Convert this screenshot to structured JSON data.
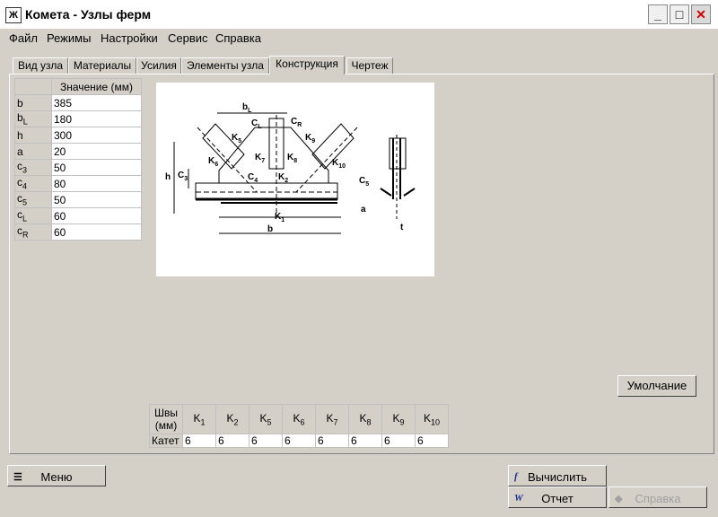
{
  "window": {
    "title": "Комета - Узлы ферм",
    "app_icon": "Ж"
  },
  "menu": [
    "Файл",
    "Режимы",
    "Настройки",
    "Сервис",
    "Справка"
  ],
  "tabs": [
    "Вид узла",
    "Материалы",
    "Усилия",
    "Элементы узла",
    "Конструкция",
    "Чертеж"
  ],
  "active_tab": 4,
  "params": {
    "header": "Значение (мм)",
    "rows": [
      {
        "key": "b",
        "sub": "",
        "value": "385"
      },
      {
        "key": "b",
        "sub": "L",
        "value": "180"
      },
      {
        "key": "h",
        "sub": "",
        "value": "300"
      },
      {
        "key": "a",
        "sub": "",
        "value": "20"
      },
      {
        "key": "c",
        "sub": "3",
        "value": "50"
      },
      {
        "key": "c",
        "sub": "4",
        "value": "80"
      },
      {
        "key": "c",
        "sub": "5",
        "value": "50"
      },
      {
        "key": "c",
        "sub": "L",
        "value": "60"
      },
      {
        "key": "c",
        "sub": "R",
        "value": "60"
      }
    ]
  },
  "drawing_labels": {
    "bL": "b",
    "bL_sub": "L",
    "CL": "C",
    "CL_sub": "L",
    "CR": "C",
    "CR_sub": "R",
    "K5": "K",
    "K5_sub": "5",
    "K9": "K",
    "K9_sub": "9",
    "K6": "K",
    "K6_sub": "6",
    "K7": "K",
    "K7_sub": "7",
    "K8": "K",
    "K8_sub": "8",
    "K10": "K",
    "K10_sub": "10",
    "h": "h",
    "C3": "C",
    "C3_sub": "3",
    "C4": "C",
    "C4_sub": "4",
    "K2": "K",
    "K2_sub": "2",
    "C5": "C",
    "C5_sub": "5",
    "a": "a",
    "K1": "K",
    "K1_sub": "1",
    "b": "b",
    "t": "t"
  },
  "default_button": "Умолчание",
  "welds": {
    "header_line1": "Швы",
    "header_line2": "(мм)",
    "row_label": "Катет",
    "cols": [
      {
        "k": "K",
        "sub": "1",
        "value": "6"
      },
      {
        "k": "K",
        "sub": "2",
        "value": "6"
      },
      {
        "k": "K",
        "sub": "5",
        "value": "6"
      },
      {
        "k": "K",
        "sub": "6",
        "value": "6"
      },
      {
        "k": "K",
        "sub": "7",
        "value": "6"
      },
      {
        "k": "K",
        "sub": "8",
        "value": "6"
      },
      {
        "k": "K",
        "sub": "9",
        "value": "6"
      },
      {
        "k": "K",
        "sub": "10",
        "value": "6"
      }
    ]
  },
  "buttons": {
    "menu": "Меню",
    "calc": "Вычислить",
    "report": "Отчет",
    "help": "Справка",
    "calc_icon": "f",
    "report_icon": "W"
  }
}
